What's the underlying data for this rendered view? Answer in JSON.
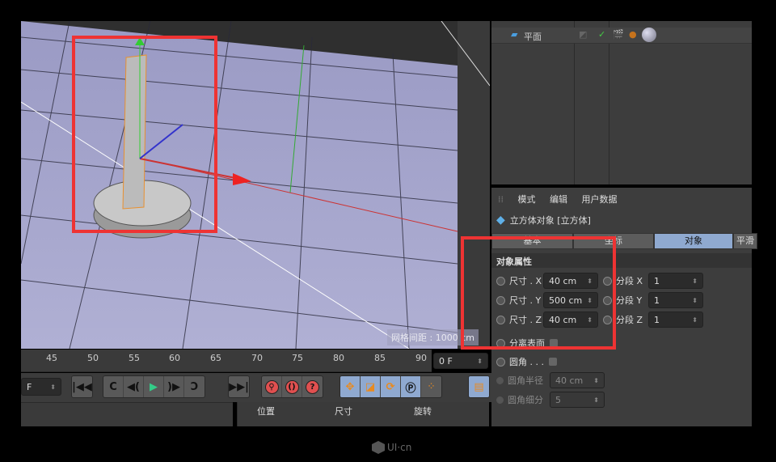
{
  "viewport": {
    "grid_spacing_label": "网格间距 : 1000 cm"
  },
  "object_manager": {
    "items": [
      {
        "name": "平面"
      }
    ]
  },
  "timeline": {
    "ticks": [
      "45",
      "50",
      "55",
      "60",
      "65",
      "70",
      "75",
      "80",
      "85",
      "90"
    ],
    "current_frame": "0 F",
    "start_frame": "F"
  },
  "coordinates": {
    "headers": [
      "位置",
      "尺寸",
      "旋转"
    ]
  },
  "attributes": {
    "menu": [
      "模式",
      "编辑",
      "用户数据"
    ],
    "object_title": "立方体对象 [立方体]",
    "tabs": [
      "基本",
      "坐标",
      "对象",
      "平滑"
    ],
    "active_tab": "对象",
    "section": "对象属性",
    "size_x_label": "尺寸 . X",
    "size_x": "40 cm",
    "size_y_label": "尺寸 . Y",
    "size_y": "500 cm",
    "size_z_label": "尺寸 . Z",
    "size_z": "40 cm",
    "seg_x_label": "分段 X",
    "seg_x": "1",
    "seg_y_label": "分段 Y",
    "seg_y": "1",
    "seg_z_label": "分段 Z",
    "seg_z": "1",
    "separate_surfaces": "分离表面",
    "fillet": "圆角 . . .",
    "fillet_radius_label": "圆角半径",
    "fillet_radius": "40 cm",
    "fillet_subdiv_label": "圆角细分",
    "fillet_subdiv": "5"
  },
  "watermark": "UI·cn",
  "colors": {
    "highlight": "#ee3333",
    "active_tab": "#8fa9d0",
    "viewport_floor": "#a9a9cf"
  }
}
